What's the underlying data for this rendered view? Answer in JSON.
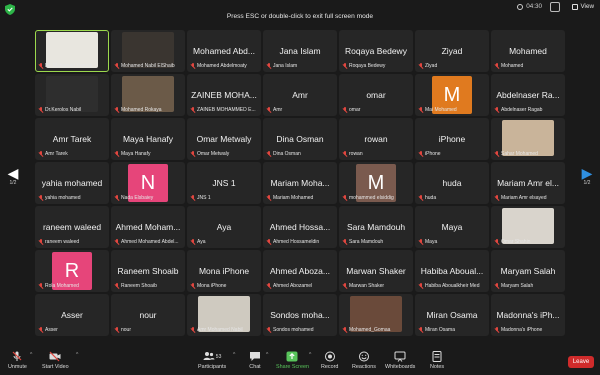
{
  "banner": "Press ESC or double-click to exit full screen mode",
  "clock": "04:30",
  "view_label": "View",
  "pager": {
    "left": "1/2",
    "right": "1/2"
  },
  "tiles": [
    {
      "big": "",
      "small": "Dr. Mohamed Hamdy",
      "kind": "photo",
      "color": "#e8e6df",
      "active": true
    },
    {
      "big": "",
      "small": "Mohamed Nabil ElShaib",
      "kind": "photo",
      "color": "#3a3530"
    },
    {
      "big": "Mohamed Abd...",
      "small": "Mohamed Abdelmoaty"
    },
    {
      "big": "Jana Islam",
      "small": "Jana Islam"
    },
    {
      "big": "Roqaya Bedewy",
      "small": "Roqaya Bedewy"
    },
    {
      "big": "Ziyad",
      "small": "Ziyad"
    },
    {
      "big": "Mohamed",
      "small": "Mohamed"
    },
    {
      "big": "",
      "small": "Dr.Kerolos Nabil",
      "kind": "photo",
      "color": "#2e2e2e"
    },
    {
      "big": "",
      "small": "Mohamed Rokaya",
      "kind": "photo",
      "color": "#6b5a48"
    },
    {
      "big": "ZAINEB MOHA...",
      "small": "ZAINEB MOHAMMED E..."
    },
    {
      "big": "Amr",
      "small": "Amr"
    },
    {
      "big": "omar",
      "small": "omar"
    },
    {
      "big": "",
      "small": "Mai Mohamed",
      "kind": "letter",
      "letter": "M",
      "color": "#e07a1f"
    },
    {
      "big": "Abdelnaser Ra...",
      "small": "Abdelnaser Ragab"
    },
    {
      "big": "Amr Tarek",
      "small": "Amr Tarek"
    },
    {
      "big": "Maya Hanafy",
      "small": "Maya Hanafy"
    },
    {
      "big": "Omar Metwaly",
      "small": "Omar Metwaly"
    },
    {
      "big": "Dina Osman",
      "small": "Dina Osman"
    },
    {
      "big": "rowan",
      "small": "rowan"
    },
    {
      "big": "iPhone",
      "small": "iPhone"
    },
    {
      "big": "",
      "small": "Sahar Mohamed",
      "kind": "photo",
      "color": "#c9b49a"
    },
    {
      "big": "yahia mohamed",
      "small": "yahia mohamed"
    },
    {
      "big": "",
      "small": "Nada Elsbaiey",
      "kind": "letter",
      "letter": "N",
      "color": "#e6457a"
    },
    {
      "big": "JNS 1",
      "small": "JNS 1"
    },
    {
      "big": "Mariam Moha...",
      "small": "Mariam Mohamed"
    },
    {
      "big": "",
      "small": "mohammed elsiddig",
      "kind": "letter",
      "letter": "M",
      "color": "#7a5a4e"
    },
    {
      "big": "huda",
      "small": "huda"
    },
    {
      "big": "Mariam Amr el...",
      "small": "Mariam Amr elsayed"
    },
    {
      "big": "raneem waleed",
      "small": "raneem waleed"
    },
    {
      "big": "Ahmed Moham...",
      "small": "Ahmed Mohamed Abdel..."
    },
    {
      "big": "Aya",
      "small": "Aya"
    },
    {
      "big": "Ahmed Hossa...",
      "small": "Ahmed Hossameldin"
    },
    {
      "big": "Sara Mamdouh",
      "small": "Sara Mamdouh"
    },
    {
      "big": "Maya",
      "small": "Maya"
    },
    {
      "big": "",
      "small": "Omar Shahin",
      "kind": "photo",
      "color": "#d9d4cc"
    },
    {
      "big": "",
      "small": "Rola Mohamed",
      "kind": "letter",
      "letter": "R",
      "color": "#e6457a"
    },
    {
      "big": "Raneem Shoaib",
      "small": "Raneem Shoaib"
    },
    {
      "big": "Mona iPhone",
      "small": "Mona iPhone"
    },
    {
      "big": "Ahmed Aboza...",
      "small": "Ahmed Abozamel"
    },
    {
      "big": "Marwan Shaker",
      "small": "Marwan Shaker"
    },
    {
      "big": "Habiba Aboual...",
      "small": "Habiba Aboualkheir Med"
    },
    {
      "big": "Maryam Salah",
      "small": "Maryam Salah"
    },
    {
      "big": "Asser",
      "small": "Asser"
    },
    {
      "big": "nour",
      "small": "nour"
    },
    {
      "big": "",
      "small": "Amr Mohamed Nabil",
      "kind": "photo",
      "color": "#cfcac0"
    },
    {
      "big": "Sondos moha...",
      "small": "Sondos mohamed"
    },
    {
      "big": "",
      "small": "Mohamed_Gomaa",
      "kind": "photo",
      "color": "#6a4a3a"
    },
    {
      "big": "Miran Osama",
      "small": "Miran Osama"
    },
    {
      "big": "Madonna's iPh...",
      "small": "Madonna's iPhone"
    }
  ],
  "toolbar": {
    "unmute": "Unmute",
    "start_video": "Start Video",
    "participants": "Participants",
    "participants_count": "53",
    "chat": "Chat",
    "share_screen": "Share Screen",
    "record": "Record",
    "reactions": "Reactions",
    "whiteboards": "Whiteboards",
    "notes": "Notes",
    "leave": "Leave"
  },
  "colors": {
    "active_border": "#9cd94d",
    "mute_red": "#e2463f",
    "share_green": "#58c45b",
    "leave_red": "#cf2b2b"
  }
}
